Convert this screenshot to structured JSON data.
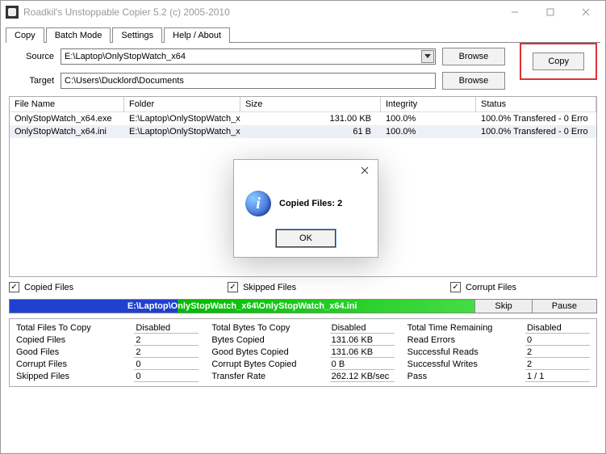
{
  "window": {
    "title": "Roadkil's Unstoppable Copier 5.2 (c) 2005-2010"
  },
  "tabs": [
    "Copy",
    "Batch Mode",
    "Settings",
    "Help / About"
  ],
  "form": {
    "source_label": "Source",
    "target_label": "Target",
    "source_value": "E:\\Laptop\\OnlyStopWatch_x64",
    "target_value": "C:\\Users\\Ducklord\\Documents",
    "browse_label": "Browse",
    "copy_label": "Copy"
  },
  "columns": {
    "file": "File Name",
    "folder": "Folder",
    "size": "Size",
    "integrity": "Integrity",
    "status": "Status"
  },
  "rows": [
    {
      "file": "OnlyStopWatch_x64.exe",
      "folder": "E:\\Laptop\\OnlyStopWatch_x",
      "size": "131.00 KB",
      "integrity": "100.0%",
      "status": "100.0% Transfered - 0 Erro"
    },
    {
      "file": "OnlyStopWatch_x64.ini",
      "folder": "E:\\Laptop\\OnlyStopWatch_x",
      "size": "61 B",
      "integrity": "100.0%",
      "status": "100.0% Transfered - 0 Erro"
    }
  ],
  "filters": {
    "copied": "Copied Files",
    "skipped": "Skipped Files",
    "corrupt": "Corrupt Files"
  },
  "progress": {
    "text": "E:\\Laptop\\OnlyStopWatch_x64\\OnlyStopWatch_x64.ini",
    "skip": "Skip",
    "pause": "Pause"
  },
  "stats": {
    "c1": [
      {
        "k": "Total Files To Copy",
        "v": "Disabled"
      },
      {
        "k": "Copied Files",
        "v": "2"
      },
      {
        "k": "Good Files",
        "v": "2"
      },
      {
        "k": "Corrupt Files",
        "v": "0"
      },
      {
        "k": "Skipped Files",
        "v": "0"
      }
    ],
    "c2": [
      {
        "k": "Total Bytes To Copy",
        "v": "Disabled"
      },
      {
        "k": "Bytes Copied",
        "v": "131.06 KB"
      },
      {
        "k": "Good Bytes Copied",
        "v": "131.06 KB"
      },
      {
        "k": "Corrupt Bytes Copied",
        "v": "0 B"
      },
      {
        "k": "Transfer Rate",
        "v": "262.12 KB/sec"
      }
    ],
    "c3": [
      {
        "k": "Total Time Remaining",
        "v": "Disabled"
      },
      {
        "k": "Read Errors",
        "v": "0"
      },
      {
        "k": "Successful Reads",
        "v": "2"
      },
      {
        "k": "Successful Writes",
        "v": "2"
      },
      {
        "k": "Pass",
        "v": "1 / 1"
      }
    ]
  },
  "dialog": {
    "message": "Copied Files: 2",
    "ok": "OK"
  }
}
